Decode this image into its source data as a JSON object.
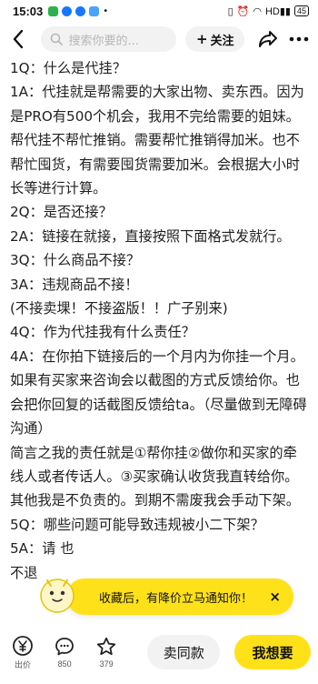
{
  "status_bar": {
    "time": "15:03",
    "right_text": "HDᵃ   ",
    "battery": "45",
    "colors": {
      "app1": "#2bb24c",
      "app2": "#1677ff",
      "app3": "#1677ff",
      "app4": "#4aa3ff"
    }
  },
  "nav": {
    "search_placeholder": "搜索你要的...",
    "follow_label": "关注",
    "follow_plus": "+"
  },
  "content": {
    "lines": [
      "1Q：什么是代挂？",
      "1A：代挂就是帮需要的大家出物、卖东西。因为是PRO有500个机会，我用不完给需要的姐妹。帮代挂不帮忙推销。需要帮忙推销得加米。也不帮忙囤货，有需要囤货需要加米。会根据大小时长等进行计算。",
      "2Q：是否还接？",
      "2A：链接在就接，直接按照下面格式发就行。",
      "3Q：什么商品不接？",
      "3A：违规商品不接！",
      "(不接卖堁！不接盗版！！广子别来)",
      "4Q：作为代挂我有什么责任？",
      "4A：在你拍下链接后的一个月内为你挂一个月。如果有买家来咨询会以截图的方式反馈给你。也会把你回复的话截图反馈给ta。（尽量做到无障碍沟通）",
      "简言之我的责任就是①帮你挂②做你和买家的牵线人或者传话人。③买家确认收货我直转给你。其他我是不负责的。到期不需废我会手动下架。",
      "5Q：哪些问题可能导致违规被小二下架？",
      "5A：请                                                      也",
      "不退"
    ]
  },
  "toast": {
    "message": "收藏后，有降价立马通知你！",
    "close": "×"
  },
  "bottom": {
    "price_label": "出价",
    "comment_count": "850",
    "favorite_count": "379",
    "same_label": "卖同款",
    "want_label": "我想要"
  }
}
